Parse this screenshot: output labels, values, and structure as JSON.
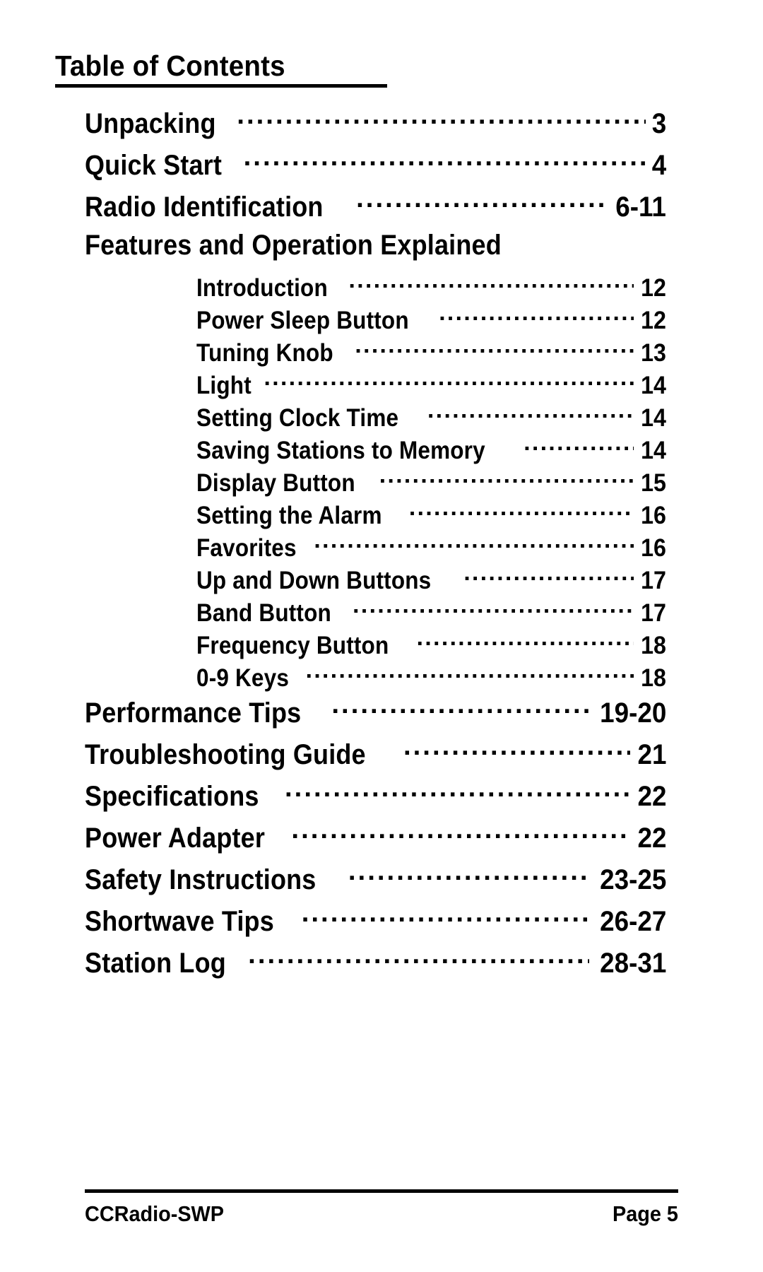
{
  "document": {
    "title": "Table of Contents",
    "product_name": "CCRadio-SWP",
    "page_label": "Page 5"
  },
  "toc": {
    "heading": "Table of Contents",
    "entries": [
      {
        "label": "Unpacking",
        "page": "3",
        "level": 1,
        "leader": true
      },
      {
        "label": "Quick Start",
        "page": "4",
        "level": 1,
        "leader": true
      },
      {
        "label": "Radio Identification",
        "page": "6-11",
        "level": 1,
        "leader": true
      },
      {
        "label": "Features and Operation Explained",
        "page": "",
        "level": 1,
        "leader": false
      },
      {
        "label": "Introduction",
        "page": "12",
        "level": 2,
        "leader": true
      },
      {
        "label": "Power Sleep Button",
        "page": "12",
        "level": 2,
        "leader": true
      },
      {
        "label": "Tuning Knob",
        "page": "13",
        "level": 2,
        "leader": true
      },
      {
        "label": "Light",
        "page": "14",
        "level": 2,
        "leader": true
      },
      {
        "label": "Setting Clock Time",
        "page": "14",
        "level": 2,
        "leader": true
      },
      {
        "label": "Saving Stations to Memory",
        "page": "14",
        "level": 2,
        "leader": true
      },
      {
        "label": "Display  Button",
        "page": "15",
        "level": 2,
        "leader": true
      },
      {
        "label": "Setting the Alarm",
        "page": "16",
        "level": 2,
        "leader": true
      },
      {
        "label": "Favorites",
        "page": "16",
        "level": 2,
        "leader": true
      },
      {
        "label": "Up and Down Buttons",
        "page": "17",
        "level": 2,
        "leader": true
      },
      {
        "label": "Band  Button",
        "page": "17",
        "level": 2,
        "leader": true
      },
      {
        "label": "Frequency Button",
        "page": "18",
        "level": 2,
        "leader": true
      },
      {
        "label": "0-9 Keys",
        "page": "18",
        "level": 2,
        "leader": true
      },
      {
        "label": "Performance  Tips",
        "page": "19-20",
        "level": 1,
        "leader": true
      },
      {
        "label": "Troubleshooting Guide",
        "page": "21",
        "level": 1,
        "leader": true
      },
      {
        "label": "Specifications",
        "page": "22",
        "level": 1,
        "leader": true
      },
      {
        "label": "Power  Adapter",
        "page": "22",
        "level": 1,
        "leader": true
      },
      {
        "label": "Safety Instructions",
        "page": "23-25",
        "level": 1,
        "leader": true
      },
      {
        "label": "Shortwave Tips",
        "page": "26-27",
        "level": 1,
        "leader": true
      },
      {
        "label": "Station Log",
        "page": "28-31",
        "level": 1,
        "leader": true
      }
    ]
  },
  "footer": {
    "left_text": "CCRadio-SWP",
    "right_text": "Page 5"
  },
  "colors": {
    "text": "#000000",
    "background": "#ffffff",
    "rule": "#000000"
  }
}
